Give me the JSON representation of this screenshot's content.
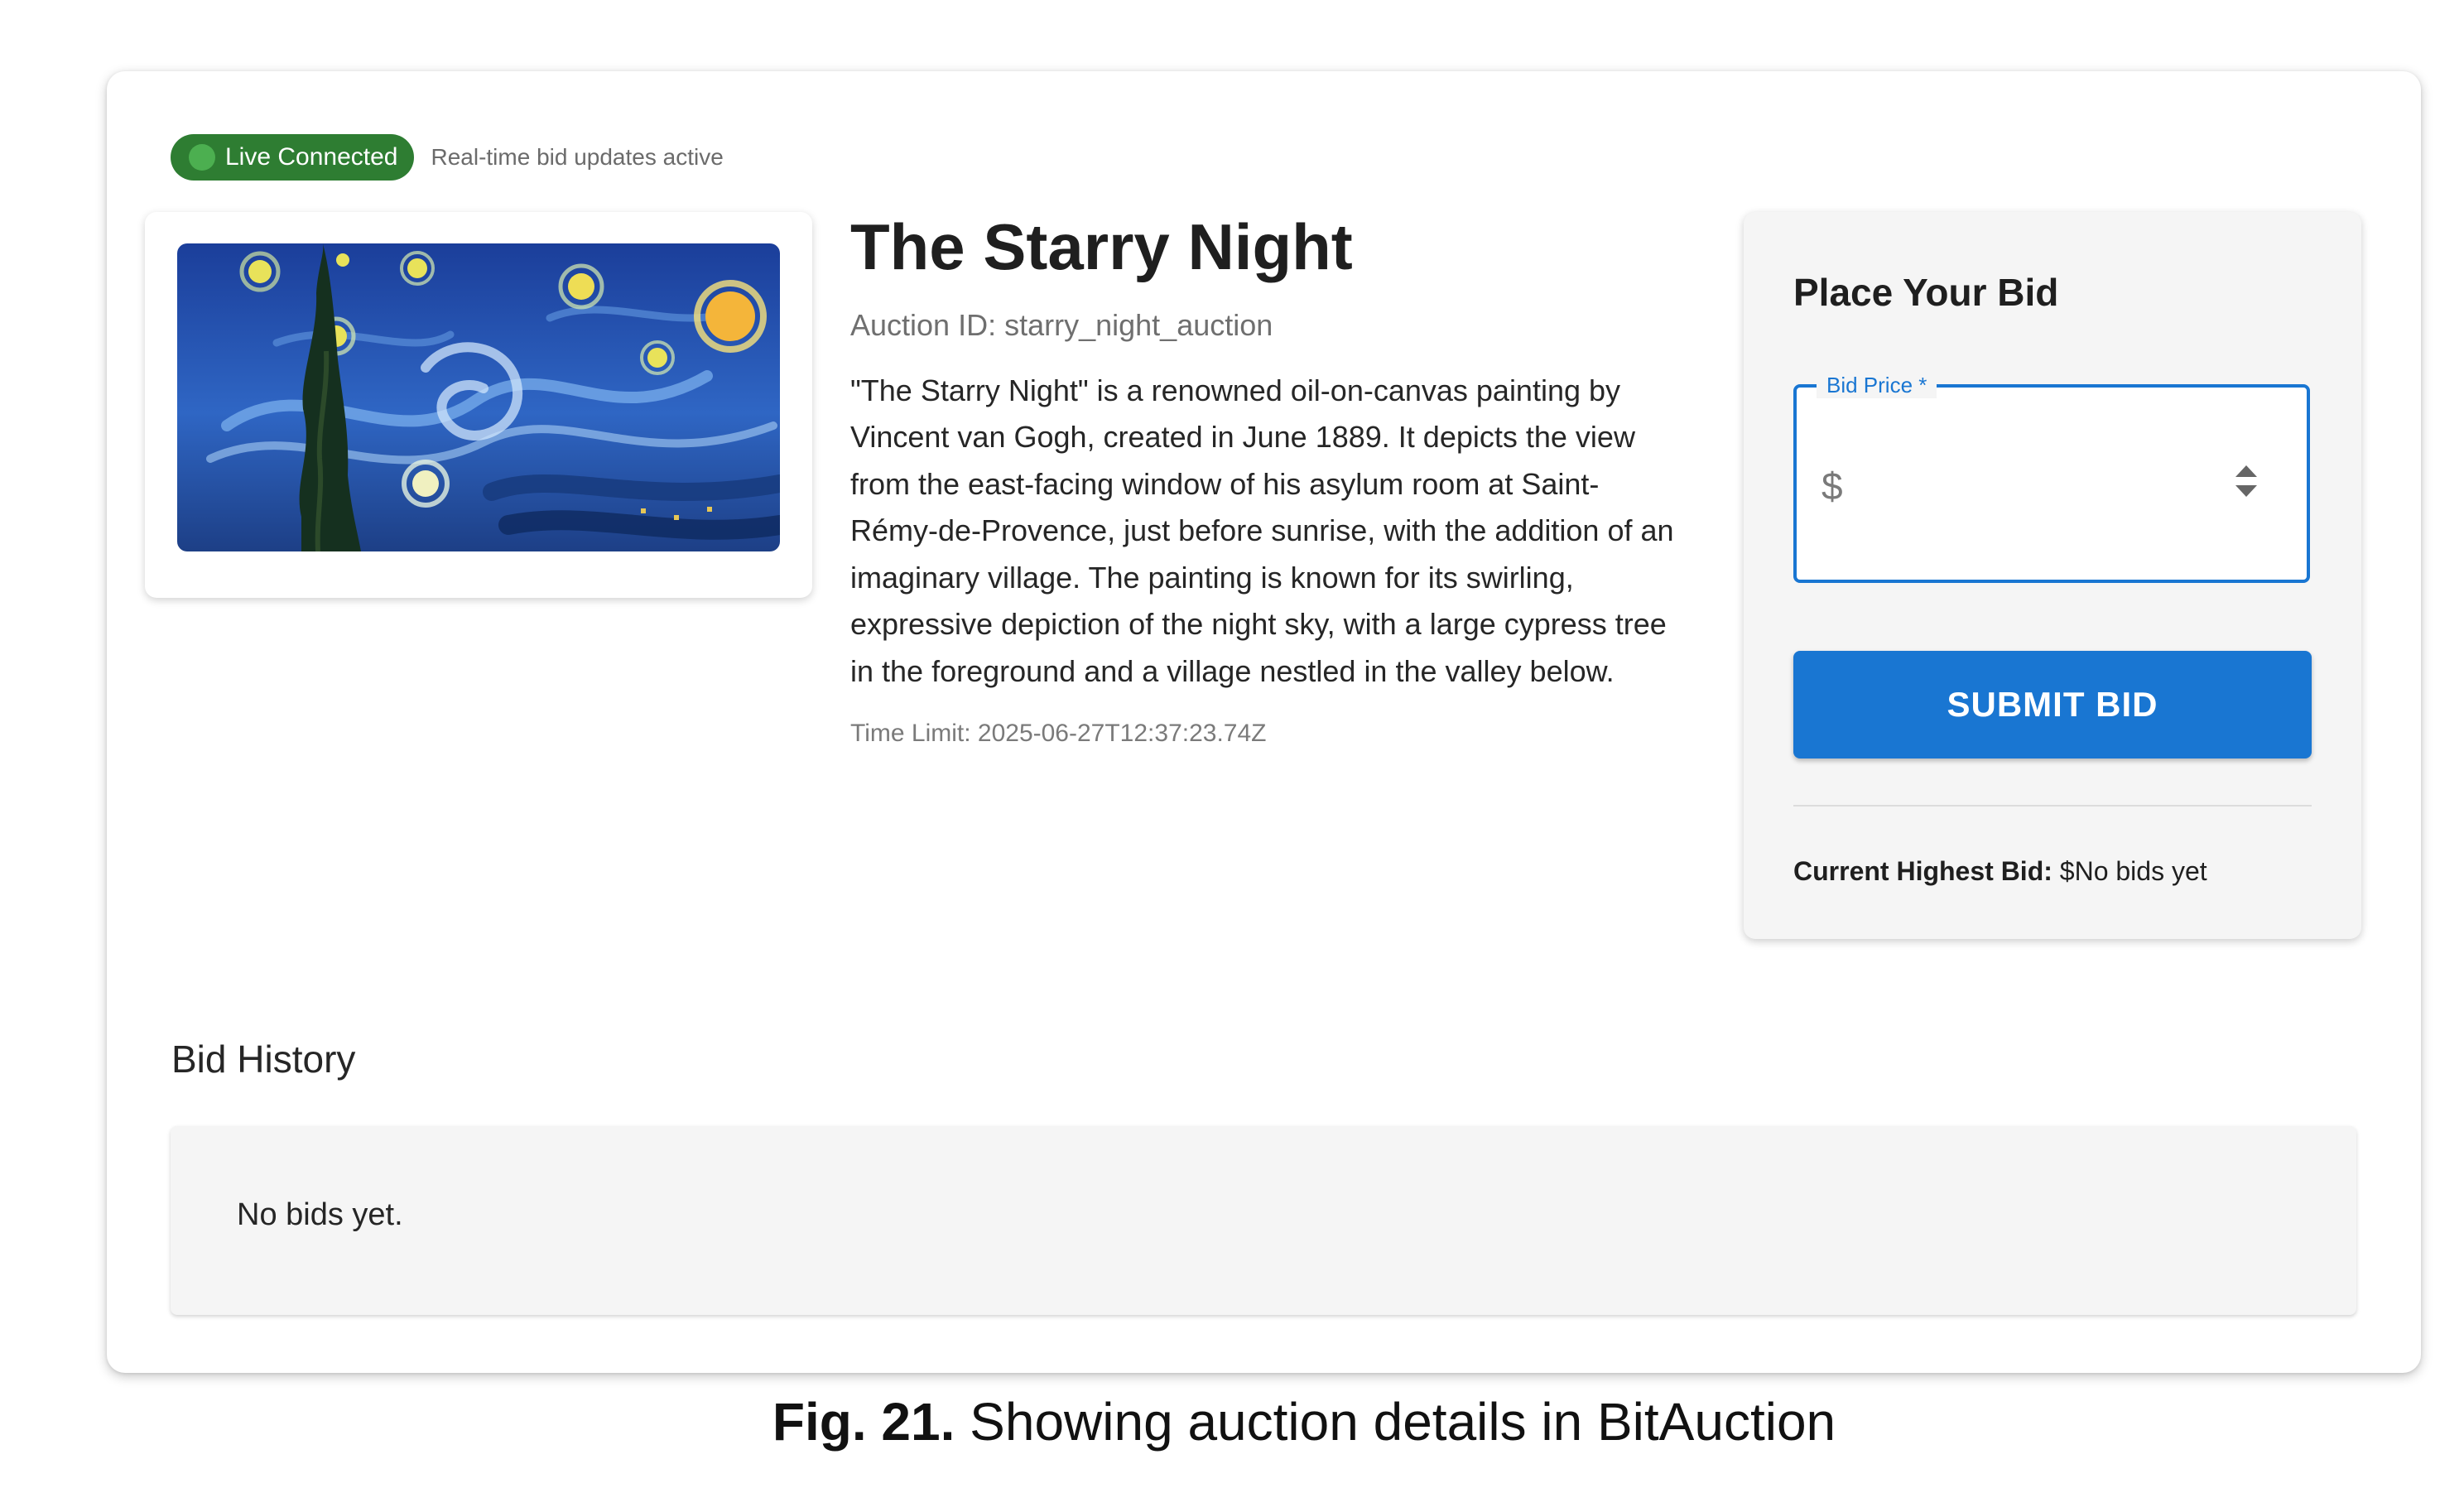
{
  "status": {
    "badge_label": "Live Connected",
    "badge_color": "#2e7d32",
    "subtitle": "Real-time bid updates active"
  },
  "auction": {
    "title": "The Starry Night",
    "auction_id": "Auction ID: starry_night_auction",
    "description": "\"The Starry Night\" is a renowned oil-on-canvas painting by Vincent van Gogh, created in June 1889. It depicts the view from the east-facing window of his asylum room at Saint-Rémy-de-Provence, just before sunrise, with the addition of an imaginary village. The painting is known for its swirling, expressive depiction of the night sky, with a large cypress tree in the foreground and a village nestled in the valley below.",
    "time_limit": "Time Limit: 2025-06-27T12:37:23.74Z"
  },
  "bid_form": {
    "title": "Place Your Bid",
    "field_label": "Bid Price *",
    "currency_symbol": "$",
    "field_value": "",
    "submit_label": "SUBMIT BID",
    "accent_color": "#1976d2",
    "highest_label": "Current Highest Bid:",
    "highest_value": "$No bids yet"
  },
  "history": {
    "title": "Bid History",
    "empty_text": "No bids yet."
  },
  "caption": {
    "prefix": "Fig. 21.",
    "text": "Showing auction details in BitAuction"
  }
}
